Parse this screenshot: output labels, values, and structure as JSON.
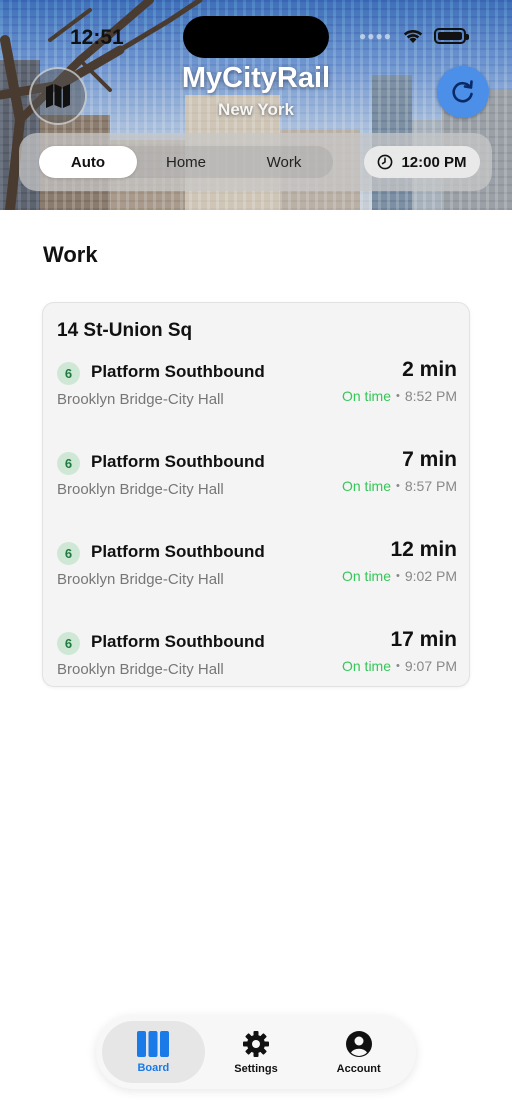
{
  "status_bar": {
    "time": "12:51"
  },
  "header": {
    "app_title": "MyCityRail",
    "city": "New York",
    "map_button_icon": "map-icon",
    "refresh_button_icon": "refresh-icon"
  },
  "mode_selector": {
    "options": [
      "Auto",
      "Home",
      "Work"
    ],
    "selected": "Auto",
    "time_label": "12:00 PM",
    "time_icon": "clock-icon"
  },
  "board": {
    "section_title": "Work",
    "station": "14 St-Union Sq",
    "arrivals": [
      {
        "route": "6",
        "platform": "Platform Southbound",
        "destination": "Brooklyn Bridge-City Hall",
        "minutes": "2 min",
        "status": "On time",
        "time": "8:52 PM"
      },
      {
        "route": "6",
        "platform": "Platform Southbound",
        "destination": "Brooklyn Bridge-City Hall",
        "minutes": "7 min",
        "status": "On time",
        "time": "8:57 PM"
      },
      {
        "route": "6",
        "platform": "Platform Southbound",
        "destination": "Brooklyn Bridge-City Hall",
        "minutes": "12 min",
        "status": "On time",
        "time": "9:02 PM"
      },
      {
        "route": "6",
        "platform": "Platform Southbound",
        "destination": "Brooklyn Bridge-City Hall",
        "minutes": "17 min",
        "status": "On time",
        "time": "9:07 PM"
      }
    ]
  },
  "tabbar": {
    "items": [
      {
        "label": "Board",
        "icon": "board-icon",
        "active": true
      },
      {
        "label": "Settings",
        "icon": "gear-icon",
        "active": false
      },
      {
        "label": "Account",
        "icon": "account-icon",
        "active": false
      }
    ]
  },
  "colors": {
    "accent": "#1a7ae8",
    "on_time": "#34c759",
    "route_6_bg": "#cfe8d6",
    "route_6_text": "#1e7a3e"
  }
}
